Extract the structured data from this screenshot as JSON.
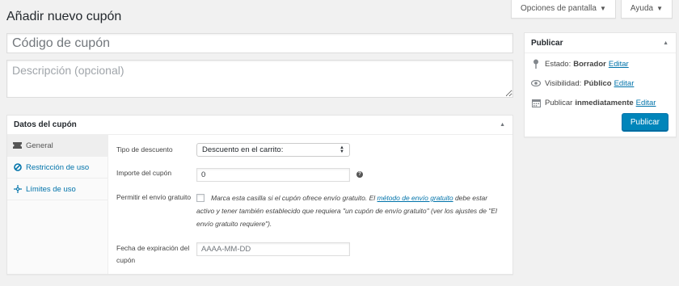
{
  "page": {
    "title": "Añadir nuevo cupón",
    "screen_options_label": "Opciones de pantalla",
    "help_label": "Ayuda"
  },
  "coupon": {
    "code_placeholder": "Código de cupón",
    "description_placeholder": "Descripción (opcional)"
  },
  "publish": {
    "title": "Publicar",
    "status_label": "Estado:",
    "status_value": "Borrador",
    "status_edit": "Editar",
    "visibility_label": "Visibilidad:",
    "visibility_value": "Público",
    "visibility_edit": "Editar",
    "publish_time_label": "Publicar",
    "publish_time_value": "inmediatamente",
    "publish_time_edit": "Editar",
    "publish_button": "Publicar"
  },
  "coupon_data": {
    "title": "Datos del cupón",
    "tabs": [
      {
        "label": "General",
        "icon": "ticket-icon"
      },
      {
        "label": "Restricción de uso",
        "icon": "restriction-icon"
      },
      {
        "label": "Límites de uso",
        "icon": "limits-icon"
      }
    ],
    "discount_type_label": "Tipo de descuento",
    "discount_type_value": "Descuento en el carrito:",
    "amount_label": "Importe del cupón",
    "amount_value": "0",
    "free_shipping_label": "Permitir el envío gratuito",
    "free_shipping_desc_before": "Marca esta casilla si el cupón ofrece envío gratuito. El ",
    "free_shipping_link": "método de envío gratuito",
    "free_shipping_desc_after": " debe estar activo y tener también establecido que requiera \"un cupón de envío gratuito\" (ver los ajustes de \"El envío gratuito requiere\").",
    "expiry_label": "Fecha de expiración del cupón",
    "expiry_placeholder": "AAAA-MM-DD"
  },
  "colors": {
    "accent": "#0085ba",
    "link": "#0073aa",
    "background": "#f1f1f1"
  }
}
